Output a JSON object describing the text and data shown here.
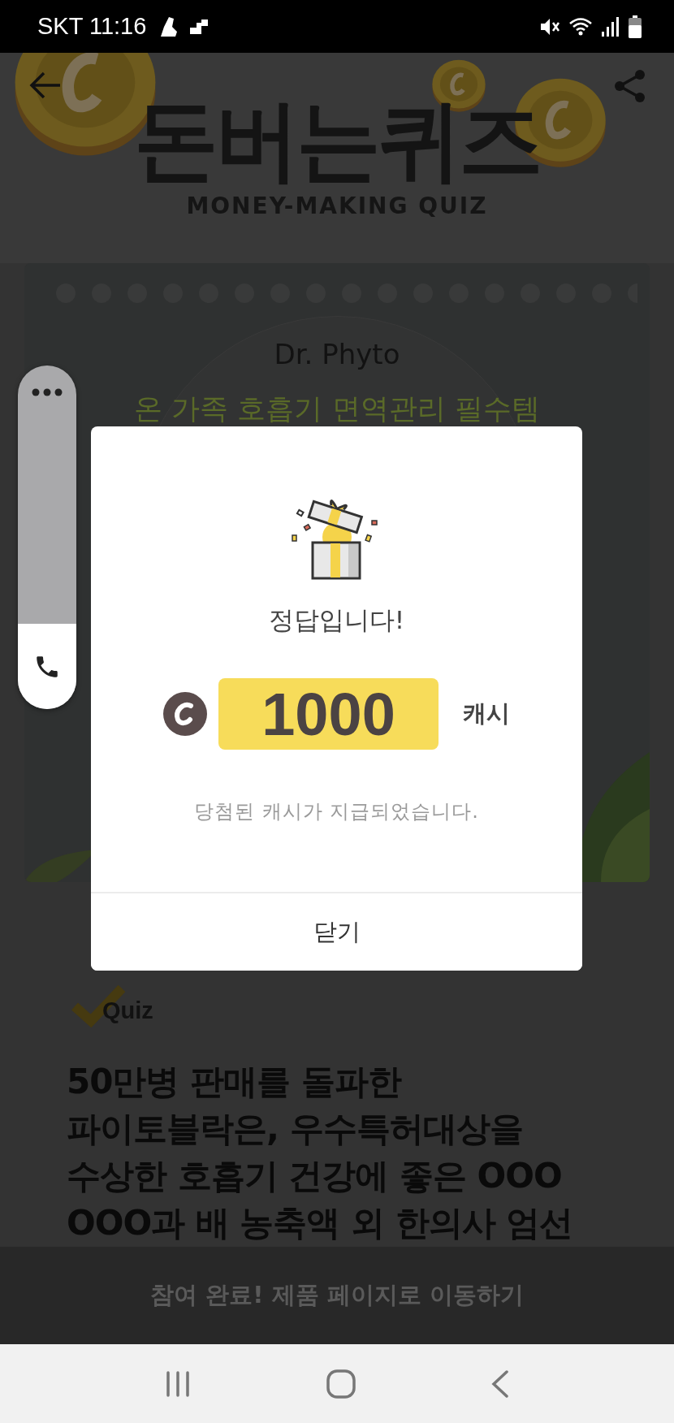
{
  "status_bar": {
    "carrier_time": "SKT 11:16"
  },
  "header": {
    "title": "돈버는퀴즈",
    "subtitle": "MONEY-MAKING QUIZ"
  },
  "ad_banner": {
    "brand": "Dr. Phyto",
    "tagline": "온 가족 호흡기 면역관리 필수템"
  },
  "quiz": {
    "label": "Quiz",
    "question_lines": [
      "50만병 판매를 돌파한",
      "파이토블락은, 우수특허대상을",
      "수상한 호흡기 건강에 좋은 OOO",
      "OOO과 배 농축액 외 한의사 엄선"
    ]
  },
  "cta_button": "참여 완료! 제품 페이지로 이동하기",
  "dialog": {
    "title": "정답입니다!",
    "amount": "1000",
    "unit": "캐시",
    "message": "당첨된 캐시가 지급되었습니다.",
    "close_button": "닫기"
  }
}
